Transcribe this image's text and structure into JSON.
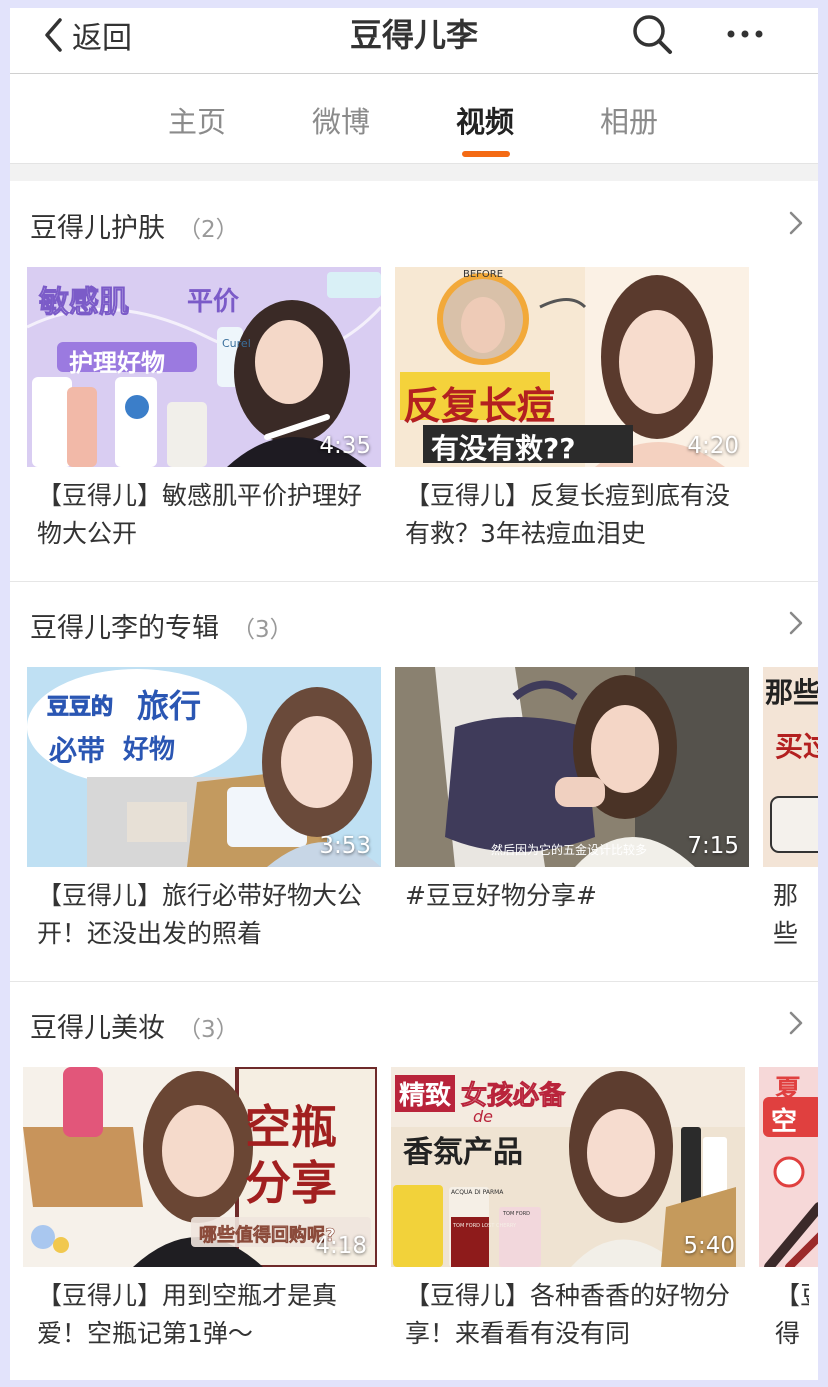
{
  "header": {
    "back_label": "返回",
    "title": "豆得儿李"
  },
  "tabs": [
    {
      "label": "主页",
      "active": false
    },
    {
      "label": "微博",
      "active": false
    },
    {
      "label": "视频",
      "active": true
    },
    {
      "label": "相册",
      "active": false
    }
  ],
  "accent_color": "#f46a14",
  "sections": [
    {
      "title": "豆得儿护肤",
      "count": "（2）",
      "videos": [
        {
          "duration": "4:35",
          "caption": "【豆得儿】敏感肌平价护理好物大公开",
          "overlay": [
            "敏感肌",
            "平价",
            "护理好物"
          ],
          "package_label": "Curel"
        },
        {
          "duration": "4:20",
          "caption": "【豆得儿】反复长痘到底有没有救？3年祛痘血泪史",
          "overlay": [
            "BEFORE",
            "反复长痘",
            "有没有救??"
          ]
        }
      ]
    },
    {
      "title": "豆得儿李的专辑",
      "count": "（3）",
      "videos": [
        {
          "duration": "3:53",
          "caption": "【豆得儿】旅行必带好物大公开！还没出发的照着",
          "overlay": [
            "豆豆的",
            "旅行",
            "必带",
            "好物"
          ]
        },
        {
          "duration": "7:15",
          "caption": "#豆豆好物分享#",
          "overlay": [
            "然后因为它的五金设计比较多"
          ]
        },
        {
          "duration": "",
          "caption": "那些包",
          "overlay": [
            "那些",
            "买过"
          ]
        }
      ]
    },
    {
      "title": "豆得儿美妆",
      "count": "（3）",
      "videos": [
        {
          "duration": "4:18",
          "caption": "【豆得儿】用到空瓶才是真爱！空瓶记第1弹～",
          "overlay": [
            "空瓶",
            "分享",
            "哪些值得回购呢?"
          ]
        },
        {
          "duration": "5:40",
          "caption": "【豆得儿】各种香香的好物分享！来看看有没有同",
          "overlay": [
            "精致",
            "女孩必备",
            "de",
            "香氛产品"
          ],
          "bottle_labels": [
            "ACQUA DI PARMA",
            "TOM FORD LOST CHERRY",
            "TOM FORD"
          ]
        },
        {
          "duration": "",
          "caption": "【豆得儿】夏日",
          "overlay": [
            "夏",
            "空"
          ]
        }
      ]
    }
  ]
}
